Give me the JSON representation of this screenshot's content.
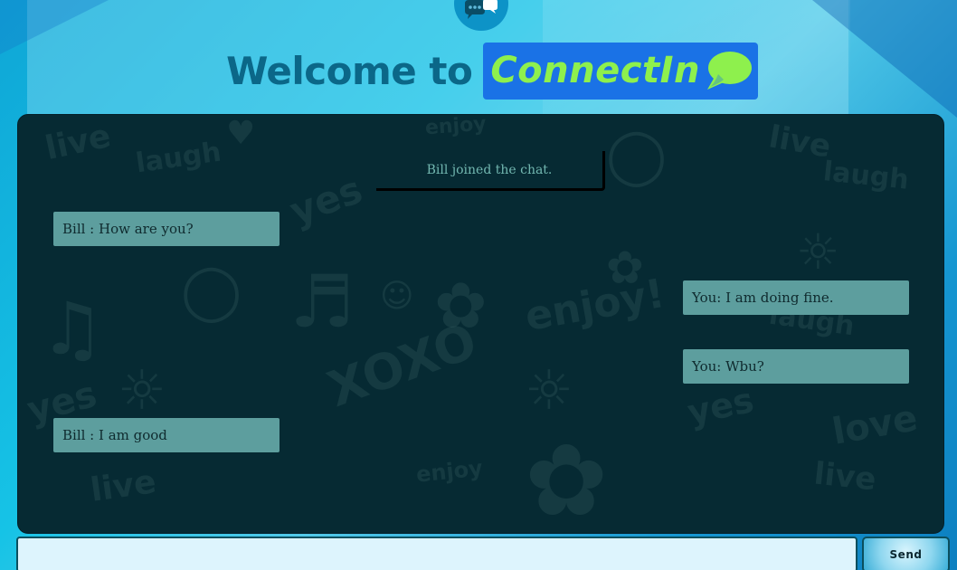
{
  "header": {
    "welcome_text": "Welcome to",
    "brand_name": "ConnectIn",
    "brand_color": "#8ef04d",
    "brand_bg": "#1a72e6",
    "logo_icon": "chat-bubbles-icon"
  },
  "chat": {
    "background_color": "#062a33",
    "notice": "Bill joined the chat.",
    "messages": [
      {
        "side": "left",
        "text": "Bill : How are you?"
      },
      {
        "side": "right",
        "text": "You: I am doing fine."
      },
      {
        "side": "right",
        "text": "You: Wbu?"
      },
      {
        "side": "left",
        "text": "Bill : I am good"
      }
    ],
    "bubble_color": "#5d9e9e"
  },
  "composer": {
    "input_value": "",
    "input_placeholder": "",
    "send_label": "Send"
  }
}
